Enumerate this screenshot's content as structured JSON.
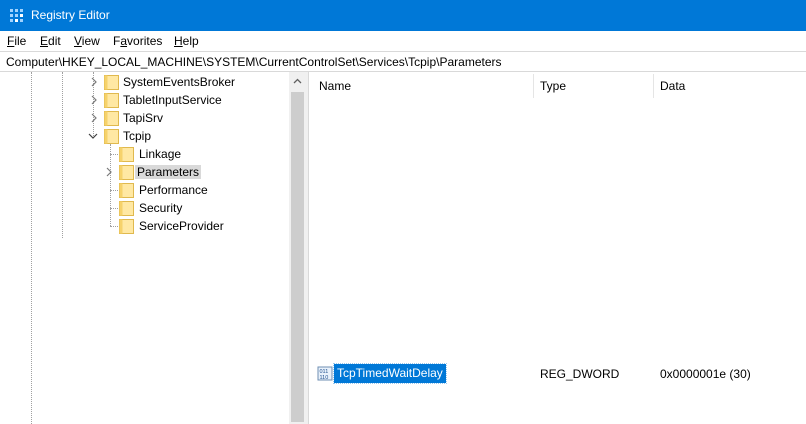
{
  "window": {
    "title": "Registry Editor",
    "accent": "#0078d7",
    "icon": "registry-editor-icon"
  },
  "menu": [
    {
      "accel": "F",
      "rest": "ile"
    },
    {
      "accel": "E",
      "rest": "dit"
    },
    {
      "accel": "V",
      "rest": "iew"
    },
    {
      "accel": "F",
      "rest": "a",
      "pre": "",
      "full": "Favorites"
    },
    {
      "accel": "H",
      "rest": "elp"
    }
  ],
  "menu_labels": {
    "favorites_pre": "",
    "favorites_accel": "a",
    "favorites_first": "F",
    "favorites_rest": "vorites"
  },
  "address": {
    "path": "Computer\\HKEY_LOCAL_MACHINE\\SYSTEM\\CurrentControlSet\\Services\\Tcpip\\Parameters"
  },
  "tree": {
    "items": [
      {
        "label": "SystemEventsBroker",
        "expandable": true,
        "expanded": false
      },
      {
        "label": "TabletInputService",
        "expandable": true,
        "expanded": false
      },
      {
        "label": "TapiSrv",
        "expandable": true,
        "expanded": false
      },
      {
        "label": "Tcpip",
        "expandable": true,
        "expanded": true
      },
      {
        "label": "Linkage",
        "expandable": false,
        "expanded": false
      },
      {
        "label": "Parameters",
        "expandable": true,
        "expanded": false,
        "selected": true
      },
      {
        "label": "Performance",
        "expandable": false,
        "expanded": false
      },
      {
        "label": "Security",
        "expandable": false,
        "expanded": false
      },
      {
        "label": "ServiceProvider",
        "expandable": false,
        "expanded": false
      }
    ]
  },
  "list": {
    "columns": {
      "name": "Name",
      "type": "Type",
      "data": "Data"
    },
    "rows": [
      {
        "name": "TcpTimedWaitDelay",
        "type": "REG_DWORD",
        "data": "0x0000001e (30)",
        "icon": "reg-dword-icon",
        "selected": true
      }
    ]
  }
}
